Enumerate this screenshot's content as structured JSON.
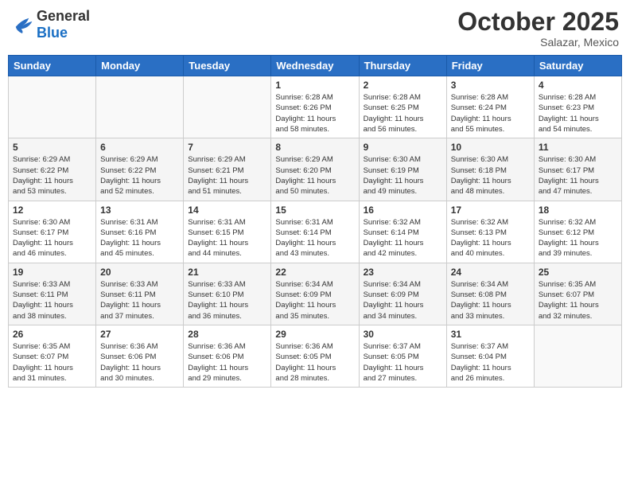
{
  "header": {
    "logo": {
      "text_general": "General",
      "text_blue": "Blue"
    },
    "title": "October 2025",
    "subtitle": "Salazar, Mexico"
  },
  "weekdays": [
    "Sunday",
    "Monday",
    "Tuesday",
    "Wednesday",
    "Thursday",
    "Friday",
    "Saturday"
  ],
  "weeks": [
    [
      {
        "day": "",
        "info": ""
      },
      {
        "day": "",
        "info": ""
      },
      {
        "day": "",
        "info": ""
      },
      {
        "day": "1",
        "info": "Sunrise: 6:28 AM\nSunset: 6:26 PM\nDaylight: 11 hours\nand 58 minutes."
      },
      {
        "day": "2",
        "info": "Sunrise: 6:28 AM\nSunset: 6:25 PM\nDaylight: 11 hours\nand 56 minutes."
      },
      {
        "day": "3",
        "info": "Sunrise: 6:28 AM\nSunset: 6:24 PM\nDaylight: 11 hours\nand 55 minutes."
      },
      {
        "day": "4",
        "info": "Sunrise: 6:28 AM\nSunset: 6:23 PM\nDaylight: 11 hours\nand 54 minutes."
      }
    ],
    [
      {
        "day": "5",
        "info": "Sunrise: 6:29 AM\nSunset: 6:22 PM\nDaylight: 11 hours\nand 53 minutes."
      },
      {
        "day": "6",
        "info": "Sunrise: 6:29 AM\nSunset: 6:22 PM\nDaylight: 11 hours\nand 52 minutes."
      },
      {
        "day": "7",
        "info": "Sunrise: 6:29 AM\nSunset: 6:21 PM\nDaylight: 11 hours\nand 51 minutes."
      },
      {
        "day": "8",
        "info": "Sunrise: 6:29 AM\nSunset: 6:20 PM\nDaylight: 11 hours\nand 50 minutes."
      },
      {
        "day": "9",
        "info": "Sunrise: 6:30 AM\nSunset: 6:19 PM\nDaylight: 11 hours\nand 49 minutes."
      },
      {
        "day": "10",
        "info": "Sunrise: 6:30 AM\nSunset: 6:18 PM\nDaylight: 11 hours\nand 48 minutes."
      },
      {
        "day": "11",
        "info": "Sunrise: 6:30 AM\nSunset: 6:17 PM\nDaylight: 11 hours\nand 47 minutes."
      }
    ],
    [
      {
        "day": "12",
        "info": "Sunrise: 6:30 AM\nSunset: 6:17 PM\nDaylight: 11 hours\nand 46 minutes."
      },
      {
        "day": "13",
        "info": "Sunrise: 6:31 AM\nSunset: 6:16 PM\nDaylight: 11 hours\nand 45 minutes."
      },
      {
        "day": "14",
        "info": "Sunrise: 6:31 AM\nSunset: 6:15 PM\nDaylight: 11 hours\nand 44 minutes."
      },
      {
        "day": "15",
        "info": "Sunrise: 6:31 AM\nSunset: 6:14 PM\nDaylight: 11 hours\nand 43 minutes."
      },
      {
        "day": "16",
        "info": "Sunrise: 6:32 AM\nSunset: 6:14 PM\nDaylight: 11 hours\nand 42 minutes."
      },
      {
        "day": "17",
        "info": "Sunrise: 6:32 AM\nSunset: 6:13 PM\nDaylight: 11 hours\nand 40 minutes."
      },
      {
        "day": "18",
        "info": "Sunrise: 6:32 AM\nSunset: 6:12 PM\nDaylight: 11 hours\nand 39 minutes."
      }
    ],
    [
      {
        "day": "19",
        "info": "Sunrise: 6:33 AM\nSunset: 6:11 PM\nDaylight: 11 hours\nand 38 minutes."
      },
      {
        "day": "20",
        "info": "Sunrise: 6:33 AM\nSunset: 6:11 PM\nDaylight: 11 hours\nand 37 minutes."
      },
      {
        "day": "21",
        "info": "Sunrise: 6:33 AM\nSunset: 6:10 PM\nDaylight: 11 hours\nand 36 minutes."
      },
      {
        "day": "22",
        "info": "Sunrise: 6:34 AM\nSunset: 6:09 PM\nDaylight: 11 hours\nand 35 minutes."
      },
      {
        "day": "23",
        "info": "Sunrise: 6:34 AM\nSunset: 6:09 PM\nDaylight: 11 hours\nand 34 minutes."
      },
      {
        "day": "24",
        "info": "Sunrise: 6:34 AM\nSunset: 6:08 PM\nDaylight: 11 hours\nand 33 minutes."
      },
      {
        "day": "25",
        "info": "Sunrise: 6:35 AM\nSunset: 6:07 PM\nDaylight: 11 hours\nand 32 minutes."
      }
    ],
    [
      {
        "day": "26",
        "info": "Sunrise: 6:35 AM\nSunset: 6:07 PM\nDaylight: 11 hours\nand 31 minutes."
      },
      {
        "day": "27",
        "info": "Sunrise: 6:36 AM\nSunset: 6:06 PM\nDaylight: 11 hours\nand 30 minutes."
      },
      {
        "day": "28",
        "info": "Sunrise: 6:36 AM\nSunset: 6:06 PM\nDaylight: 11 hours\nand 29 minutes."
      },
      {
        "day": "29",
        "info": "Sunrise: 6:36 AM\nSunset: 6:05 PM\nDaylight: 11 hours\nand 28 minutes."
      },
      {
        "day": "30",
        "info": "Sunrise: 6:37 AM\nSunset: 6:05 PM\nDaylight: 11 hours\nand 27 minutes."
      },
      {
        "day": "31",
        "info": "Sunrise: 6:37 AM\nSunset: 6:04 PM\nDaylight: 11 hours\nand 26 minutes."
      },
      {
        "day": "",
        "info": ""
      }
    ]
  ]
}
